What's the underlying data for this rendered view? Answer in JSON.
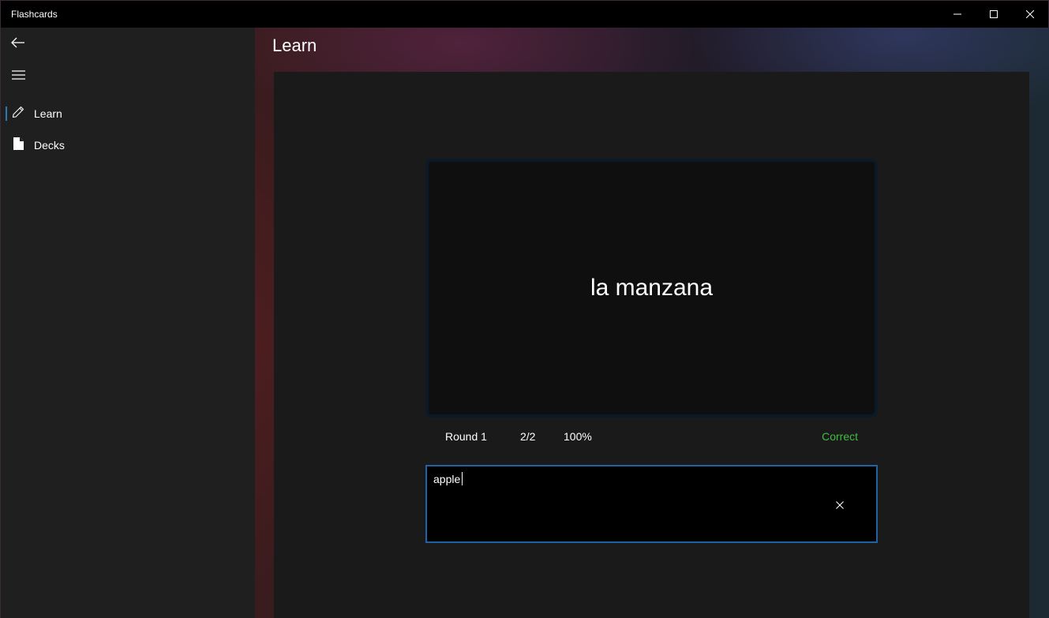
{
  "window": {
    "title": "Flashcards",
    "controls": {
      "minimize_icon": "minimize-icon",
      "maximize_icon": "maximize-icon",
      "close_icon": "close-icon"
    }
  },
  "nav": {
    "back_icon": "back-arrow-icon",
    "menu_icon": "hamburger-icon",
    "items": [
      {
        "label": "Learn",
        "icon": "pencil-icon",
        "selected": true
      },
      {
        "label": "Decks",
        "icon": "document-icon",
        "selected": false
      }
    ],
    "accent_color": "#2b79b8"
  },
  "page": {
    "title": "Learn"
  },
  "card": {
    "term": "la manzana"
  },
  "stats": {
    "round": "Round 1",
    "progress": "2/2",
    "percent": "100%",
    "result": "Correct",
    "result_color": "#3fbf3f"
  },
  "answer": {
    "value": "apple",
    "clear_icon": "clear-x-icon",
    "border_color": "#1f62a6"
  }
}
